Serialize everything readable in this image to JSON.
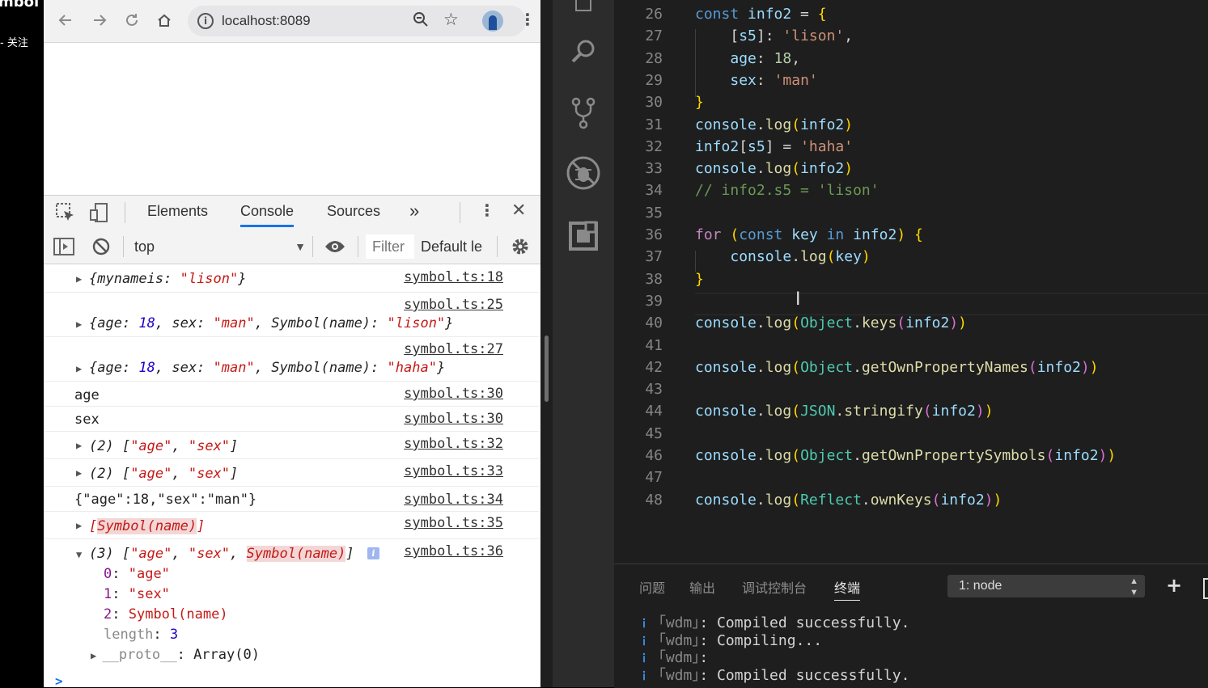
{
  "left_strip": {
    "partial_title": "mbol",
    "follow_label": "- 关注"
  },
  "browser": {
    "url": "localhost:8089",
    "devtools": {
      "tabs": [
        "Elements",
        "Console",
        "Sources"
      ],
      "more_tabs": "»",
      "active_tab": "Console",
      "context": "top",
      "filter_placeholder": "Filter",
      "levels_label": "Default le"
    },
    "console": {
      "rows": [
        {
          "message": "{mynameis: \"lison\"}",
          "source": "symbol.ts:18"
        },
        {
          "message": "{age: 18, sex: \"man\", Symbol(name): \"lison\"}",
          "source": "symbol.ts:25"
        },
        {
          "message": "{age: 18, sex: \"man\", Symbol(name): \"haha\"}",
          "source": "symbol.ts:27"
        },
        {
          "message": "age",
          "source": "symbol.ts:30"
        },
        {
          "message": "sex",
          "source": "symbol.ts:30"
        },
        {
          "message": "(2) [\"age\", \"sex\"]",
          "source": "symbol.ts:32"
        },
        {
          "message": "(2) [\"age\", \"sex\"]",
          "source": "symbol.ts:33"
        },
        {
          "message": "{\"age\":18,\"sex\":\"man\"}",
          "source": "symbol.ts:34"
        },
        {
          "message": "[Symbol(name)]",
          "source": "symbol.ts:35"
        },
        {
          "message": "(3) [\"age\", \"sex\", Symbol(name)]",
          "source": "symbol.ts:36"
        }
      ],
      "expanded": [
        {
          "key": "0",
          "value": "\"age\""
        },
        {
          "key": "1",
          "value": "\"sex\""
        },
        {
          "key": "2",
          "value": "Symbol(name)"
        },
        {
          "key": "length",
          "value": "3"
        },
        {
          "key": "__proto__",
          "value": "Array(0)"
        }
      ],
      "prompt": ">"
    }
  },
  "editor": {
    "line_numbers": [
      "26",
      "27",
      "28",
      "29",
      "30",
      "31",
      "32",
      "33",
      "34",
      "35",
      "36",
      "37",
      "38",
      "39",
      "40",
      "41",
      "42",
      "43",
      "44",
      "45",
      "46",
      "47",
      "48"
    ],
    "lines": [
      "const info2 = {",
      "    [s5]: 'lison',",
      "    age: 18,",
      "    sex: 'man'",
      "}",
      "console.log(info2)",
      "info2[s5] = 'haha'",
      "console.log(info2)",
      "// info2.s5 = 'lison'",
      "",
      "for (const key in info2) {",
      "    console.log(key)",
      "}",
      "",
      "console.log(Object.keys(info2))",
      "",
      "console.log(Object.getOwnPropertyNames(info2))",
      "",
      "console.log(JSON.stringify(info2))",
      "",
      "console.log(Object.getOwnPropertySymbols(info2))",
      "",
      "console.log(Reflect.ownKeys(info2))"
    ]
  },
  "panel": {
    "tabs": [
      "问题",
      "输出",
      "调试控制台",
      "终端"
    ],
    "active_tab": "终端",
    "terminal_select": "1: node",
    "terminal_lines": [
      {
        "prefix": "ｉ",
        "tag": "｢wdm｣",
        "text": ": Compiled successfully."
      },
      {
        "prefix": "ｉ",
        "tag": "｢wdm｣",
        "text": ": Compiling..."
      },
      {
        "prefix": "ｉ",
        "tag": "｢wdm｣",
        "text": ":"
      },
      {
        "prefix": "ｉ",
        "tag": "｢wdm｣",
        "text": ": Compiled successfully."
      }
    ]
  },
  "colors": {
    "vscode_bg": "#1e1e1e",
    "activity_bar": "#2c2c2c",
    "devtools_accent": "#1a73e8"
  }
}
